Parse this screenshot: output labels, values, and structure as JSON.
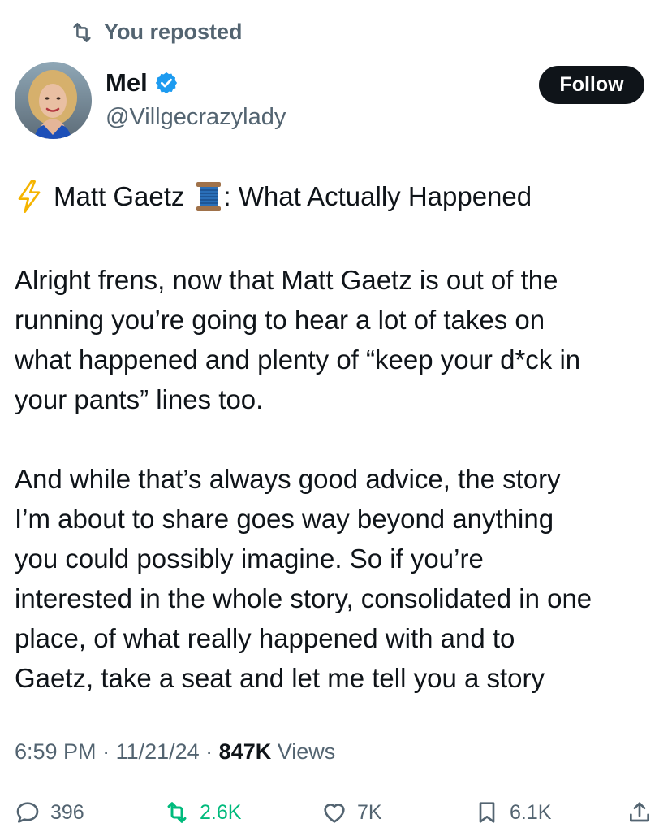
{
  "repost_banner": {
    "label": "You reposted"
  },
  "author": {
    "name": "Mel",
    "handle": "@Villgecrazylady",
    "follow_label": "Follow"
  },
  "post": {
    "title_prefix_icon": "lightning-icon",
    "title_name": "Matt Gaetz",
    "title_spool_icon": "thread-spool-icon",
    "title_rest": ": What Actually Happened",
    "paragraph1": [
      "Alright frens, now that Matt Gaetz is out of the",
      "running you’re going to hear a lot of takes on",
      "what happened and plenty of “keep your d*ck in",
      "your pants” lines too."
    ],
    "paragraph2": [
      "And while that’s always good advice, the story",
      "I’m about to share goes way beyond anything",
      "you could possibly imagine. So if you’re",
      "interested in the whole story, consolidated in one",
      "place, of what really happened with and to",
      "Gaetz, take a seat and let me tell you a story"
    ]
  },
  "meta": {
    "time": "6:59 PM",
    "sep1": " · ",
    "date": "11/21/24",
    "sep2": " · ",
    "views": "847K",
    "views_label": " Views"
  },
  "actions": {
    "replies": "396",
    "reposts": "2.6K",
    "likes": "7K",
    "bookmarks": "6.1K"
  },
  "colors": {
    "text": "#0f1419",
    "secondary": "#536471",
    "repost_active": "#00ba7c",
    "verified": "#1d9bf0",
    "follow_bg": "#0f1419"
  }
}
